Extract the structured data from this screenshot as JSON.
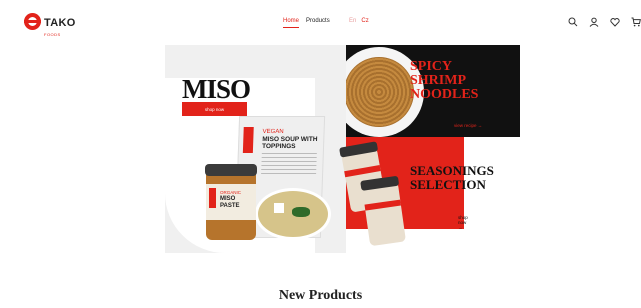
{
  "brand": {
    "name": "TAKO",
    "tagline": "FOODS"
  },
  "nav": {
    "items": [
      {
        "label": "Home",
        "active": true
      },
      {
        "label": "Products",
        "active": false
      }
    ]
  },
  "language": {
    "options": [
      "En",
      "Cz"
    ],
    "selected": "Cz"
  },
  "header_icons": [
    "search-icon",
    "user-icon",
    "heart-icon",
    "cart-icon"
  ],
  "hero": {
    "miso": {
      "title": "MISO",
      "button": "shop now",
      "bag_subtitle": "VEGAN",
      "bag_title": "MISO SOUP WITH TOPPINGS",
      "jar_subtitle": "ORGANIC",
      "jar_title": "MISO PASTE"
    },
    "noodles": {
      "title_lines": [
        "SPICY",
        "SHRIMP",
        "NOODLES"
      ],
      "cta": "view recipe →"
    },
    "seasonings": {
      "title_lines": [
        "SEASONINGS",
        "SELECTION"
      ],
      "cta": "shop now →"
    }
  },
  "section": {
    "title": "New Products"
  },
  "colors": {
    "accent": "#e2231a",
    "dark": "#111111",
    "light_bg": "#f0f0f0"
  }
}
